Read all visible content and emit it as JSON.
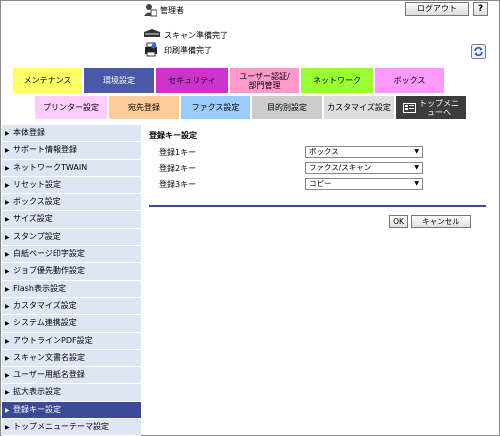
{
  "header": {
    "user_label": "管理者",
    "logout_label": "ログアウト",
    "help_label": "?",
    "status_scan": "スキャン準備完了",
    "status_print": "印刷準備完了"
  },
  "tabs_main": [
    {
      "label": "メンテナンス",
      "color": "#ffff66"
    },
    {
      "label": "環境設定",
      "color": "#4a5aa8",
      "active": true
    },
    {
      "label": "セキュリティ",
      "color": "#cc33cc"
    },
    {
      "label": "ユーザー認証/部門管理",
      "color": "#ff99cc"
    },
    {
      "label": "ネットワーク",
      "color": "#99ff33"
    },
    {
      "label": "ボックス",
      "color": "#ff99ff"
    }
  ],
  "tabs_sub": [
    {
      "label": "プリンター設定",
      "color": "#ffccff"
    },
    {
      "label": "宛先登録",
      "color": "#ffcc99"
    },
    {
      "label": "ファクス設定",
      "color": "#99ccff"
    },
    {
      "label": "目的別設定",
      "color": "#cccccc"
    },
    {
      "label": "カスタマイズ設定",
      "color": "#dddddd"
    },
    {
      "label": "トップメニューへ",
      "color": "#3c3c3c"
    }
  ],
  "sidebar": {
    "items": [
      {
        "label": "本体登録"
      },
      {
        "label": "サポート情報登録"
      },
      {
        "label": "ネットワークTWAIN"
      },
      {
        "label": "リセット設定"
      },
      {
        "label": "ボックス設定"
      },
      {
        "label": "サイズ設定"
      },
      {
        "label": "スタンプ設定"
      },
      {
        "label": "白紙ページ印字設定"
      },
      {
        "label": "ジョブ優先動作設定"
      },
      {
        "label": "Flash表示設定"
      },
      {
        "label": "カスタマイズ設定"
      },
      {
        "label": "システム連携設定"
      },
      {
        "label": "アウトラインPDF設定"
      },
      {
        "label": "スキャン文書名設定"
      },
      {
        "label": "ユーザー用紙名登録"
      },
      {
        "label": "拡大表示設定"
      },
      {
        "label": "登録キー設定",
        "active": true
      },
      {
        "label": "トップメニューテーマ設定"
      }
    ]
  },
  "main": {
    "title": "登録キー設定",
    "rows": [
      {
        "label": "登録1キー",
        "value": "ボックス"
      },
      {
        "label": "登録2キー",
        "value": "ファクス/スキャン"
      },
      {
        "label": "登録3キー",
        "value": "コピー"
      }
    ],
    "ok_label": "OK",
    "cancel_label": "キャンセル"
  }
}
